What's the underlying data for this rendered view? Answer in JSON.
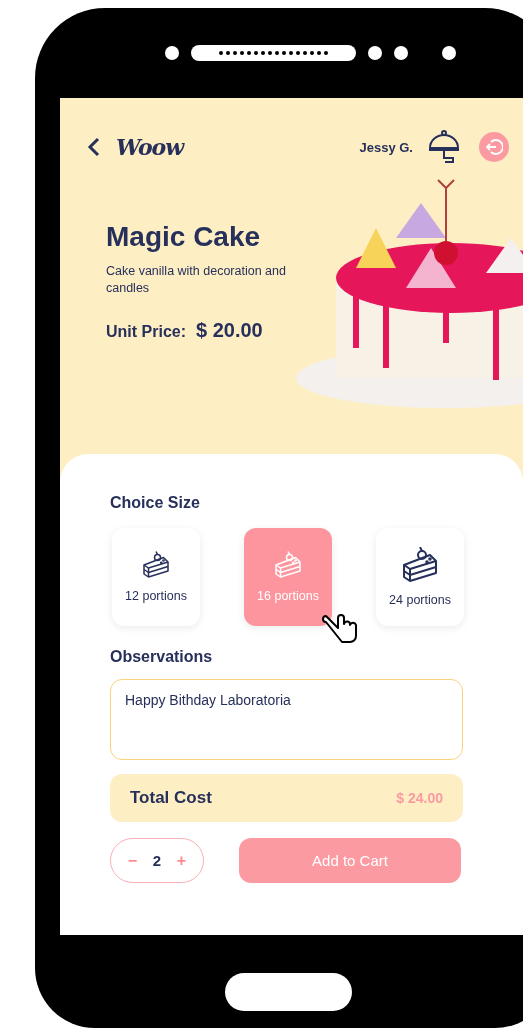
{
  "header": {
    "logo": "Woow",
    "user": "Jessy G."
  },
  "product": {
    "name": "Magic Cake",
    "description": "Cake vanilla with decoration and candles",
    "price_label": "Unit Price:",
    "price": "$ 20.00"
  },
  "sizes": {
    "title": "Choice Size",
    "options": [
      {
        "label": "12 portions",
        "selected": false
      },
      {
        "label": "16 portions",
        "selected": true
      },
      {
        "label": "24 portions",
        "selected": false
      }
    ]
  },
  "observations": {
    "title": "Observations",
    "value": "Happy Bithday Laboratoria"
  },
  "total": {
    "label": "Total Cost",
    "value": "$ 24.00"
  },
  "quantity": {
    "minus": "−",
    "value": "2",
    "plus": "+"
  },
  "add_button": "Add to Cart"
}
